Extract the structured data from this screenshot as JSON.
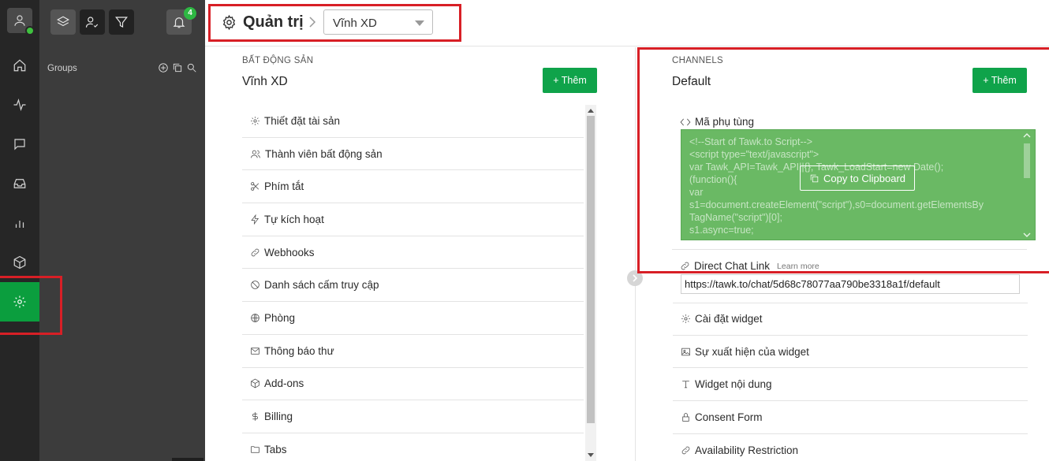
{
  "header": {
    "title": "Quản trị",
    "property_selected": "Vĩnh XD"
  },
  "sidebar": {
    "groups_label": "Groups",
    "notification_count": "4"
  },
  "property_section": {
    "kicker": "BẤT ĐỘNG SẢN",
    "title": "Vĩnh XD",
    "add_label": "+ Thêm",
    "items": [
      {
        "label": "Thiết đặt tài sản",
        "icon": "gear-icon"
      },
      {
        "label": "Thành viên bất động sản",
        "icon": "users-icon"
      },
      {
        "label": "Phím tắt",
        "icon": "scissors-icon"
      },
      {
        "label": "Tự kích hoạt",
        "icon": "bolt-icon"
      },
      {
        "label": "Webhooks",
        "icon": "link-icon"
      },
      {
        "label": "Danh sách cấm truy cập",
        "icon": "ban-icon"
      },
      {
        "label": "Phòng",
        "icon": "globe-icon"
      },
      {
        "label": "Thông báo thư",
        "icon": "mail-icon"
      },
      {
        "label": "Add-ons",
        "icon": "cube-icon"
      },
      {
        "label": "Billing",
        "icon": "dollar-icon"
      },
      {
        "label": "Tabs",
        "icon": "folder-icon"
      }
    ]
  },
  "channels_section": {
    "kicker": "CHANNELS",
    "title": "Default",
    "add_label": "+ Thêm",
    "widget_code_label": "Mã phụ tùng",
    "widget_code": "<!--Start of Tawk.to Script-->\n<script type=\"text/javascript\">\nvar Tawk_API=Tawk_API||{}, Tawk_LoadStart=new Date();\n(function(){\nvar\ns1=document.createElement(\"script\"),s0=document.getElementsBy\nTagName(\"script\")[0];\ns1.async=true;",
    "copy_label": "Copy to Clipboard",
    "direct_link_label": "Direct Chat Link",
    "learn_more": "Learn more",
    "direct_link_value": "https://tawk.to/chat/5d68c78077aa790be3318a1f/default",
    "items": [
      {
        "label": "Cài đặt widget",
        "icon": "gear-icon"
      },
      {
        "label": "Sự xuất hiện của widget",
        "icon": "image-icon"
      },
      {
        "label": "Widget nội dung",
        "icon": "text-icon"
      },
      {
        "label": "Consent Form",
        "icon": "lock-icon"
      },
      {
        "label": "Availability Restriction",
        "icon": "link-icon"
      }
    ]
  },
  "colors": {
    "accent_green": "#0fa34a",
    "annotation_red": "#d81f26",
    "rail_bg": "#262626",
    "sidebar_bg": "#3c3c3c"
  }
}
